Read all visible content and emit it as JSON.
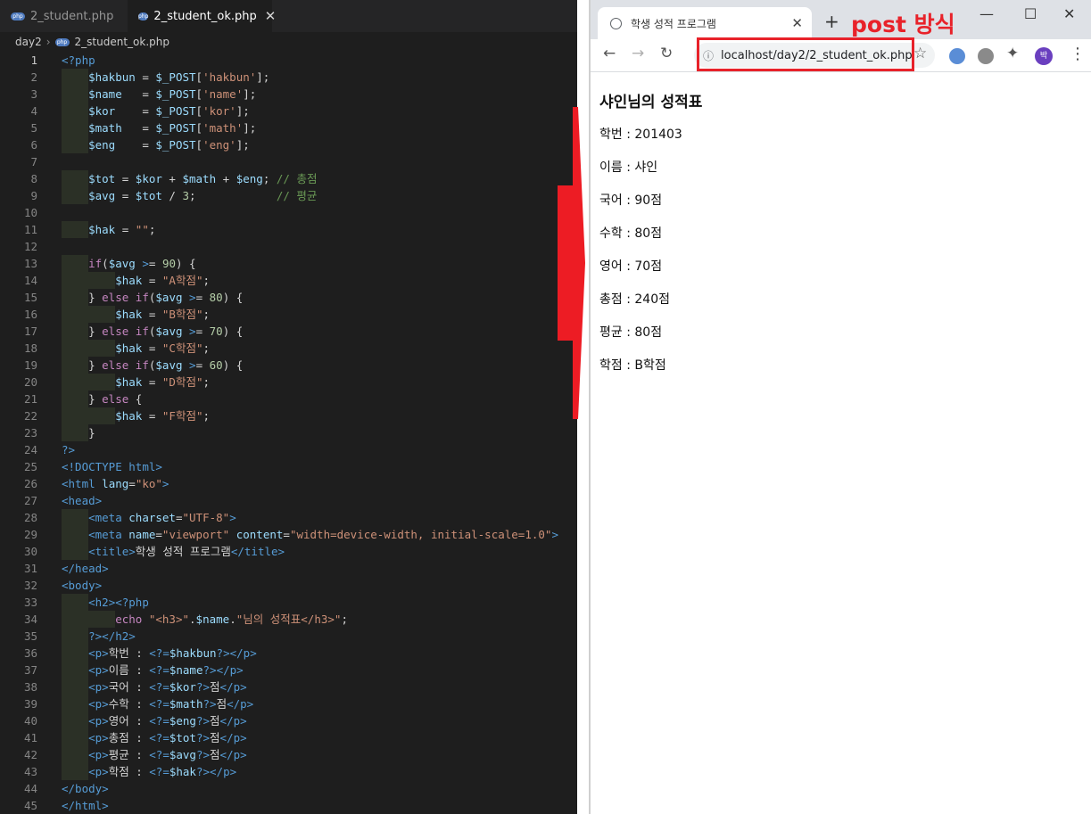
{
  "editor": {
    "tabs": [
      {
        "label": "2_student.php",
        "active": false
      },
      {
        "label": "2_student_ok.php",
        "active": true
      }
    ],
    "file_badge": "php",
    "breadcrumb": [
      "day2",
      "2_student_ok.php"
    ],
    "current_line": 1,
    "lines": [
      "<?php",
      "    $hakbun = $_POST['hakbun'];",
      "    $name   = $_POST['name'];",
      "    $kor    = $_POST['kor'];",
      "    $math   = $_POST['math'];",
      "    $eng    = $_POST['eng'];",
      "",
      "    $tot = $kor + $math + $eng; // 총점",
      "    $avg = $tot / 3;            // 평균",
      "",
      "    $hak = \"\";",
      "",
      "    if($avg >= 90) {",
      "        $hak = \"A학점\";",
      "    } else if($avg >= 80) {",
      "        $hak = \"B학점\";",
      "    } else if($avg >= 70) {",
      "        $hak = \"C학점\";",
      "    } else if($avg >= 60) {",
      "        $hak = \"D학점\";",
      "    } else {",
      "        $hak = \"F학점\";",
      "    }",
      "?>",
      "<!DOCTYPE html>",
      "<html lang=\"ko\">",
      "<head>",
      "    <meta charset=\"UTF-8\">",
      "    <meta name=\"viewport\" content=\"width=device-width, initial-scale=1.0\">",
      "    <title>학생 성적 프로그램</title>",
      "</head>",
      "<body>",
      "    <h2><?php",
      "        echo \"<h3>\".$name.\"님의 성적표</h3>\";",
      "    ?></h2>",
      "    <p>학번 : <?=$hakbun?></p>",
      "    <p>이름 : <?=$name?></p>",
      "    <p>국어 : <?=$kor?>점</p>",
      "    <p>수학 : <?=$math?>점</p>",
      "    <p>영어 : <?=$eng?>점</p>",
      "    <p>총점 : <?=$tot?>점</p>",
      "    <p>평균 : <?=$avg?>점</p>",
      "    <p>학점 : <?=$hak?></p>",
      "</body>",
      "</html>"
    ]
  },
  "browser": {
    "tab_title": "학생 성적 프로그램",
    "new_tab": "+",
    "annotation": "post 방식",
    "address": "localhost/day2/2_student_ok.php",
    "avatar_letter": "박",
    "accent_red": "#e8222a",
    "page": {
      "heading": "샤인님의 성적표",
      "rows": [
        "학번 : 201403",
        "이름 : 샤인",
        "국어 : 90점",
        "수학 : 80점",
        "영어 : 70점",
        "총점 : 240점",
        "평균 : 80점",
        "학점 : B학점"
      ]
    }
  }
}
